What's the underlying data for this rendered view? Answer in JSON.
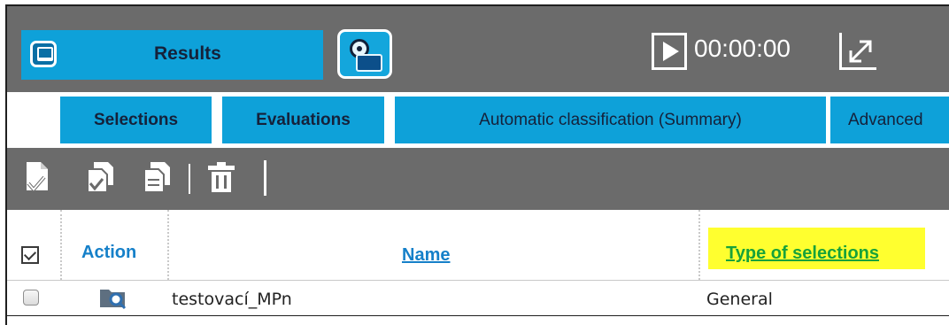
{
  "header": {
    "results_label": "Results",
    "timer": "00:00:00"
  },
  "tabs": [
    {
      "label": "Selections"
    },
    {
      "label": "Evaluations"
    },
    {
      "label": "Automatic classification (Summary)"
    },
    {
      "label": "Advanced"
    }
  ],
  "toolbar": {
    "icons": [
      "new-selection-icon",
      "copy-selection-icon",
      "duplicate-selection-icon",
      "delete-icon"
    ]
  },
  "table": {
    "columns": [
      "Action",
      "Name",
      "Type of selections"
    ],
    "rows": [
      {
        "name": "testovací_MPn",
        "type": "General",
        "action_icon": "search-folder-icon"
      }
    ]
  },
  "colors": {
    "accent_blue": "#0ea1d9",
    "toolbar_gray": "#6b6b6b",
    "highlight_yellow": "#ffff2f",
    "link_blue": "#1580c9",
    "link_green": "#17a23a"
  }
}
